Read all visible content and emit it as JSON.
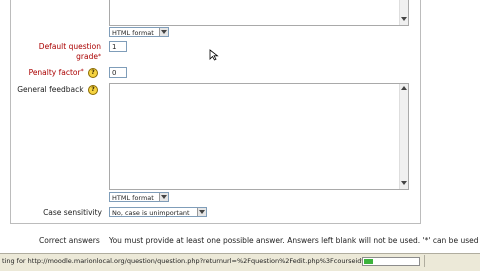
{
  "format_select_top": {
    "value": "HTML format"
  },
  "default_grade": {
    "label_line1": "Default question",
    "label_line2": "grade",
    "required_mark": "*",
    "value": "1"
  },
  "penalty": {
    "label": "Penalty factor",
    "required_mark": "*",
    "value": "0",
    "help_icon": "help-icon"
  },
  "general_feedback": {
    "label": "General feedback",
    "help_icon": "help-icon",
    "format_value": "HTML format"
  },
  "case_sensitivity": {
    "label": "Case sensitivity",
    "value": "No, case is unimportant"
  },
  "correct_answers": {
    "label": "Correct answers",
    "text": "You must provide at least one possible answer. Answers left blank will not be used. '*' can be used"
  },
  "statusbar": {
    "text": "ting for http://moodle.marionlocal.org/question/question.php?returnurl=%2Fquestion%2Fedit.php%3Fcourseid%",
    "progress": 0.17
  }
}
